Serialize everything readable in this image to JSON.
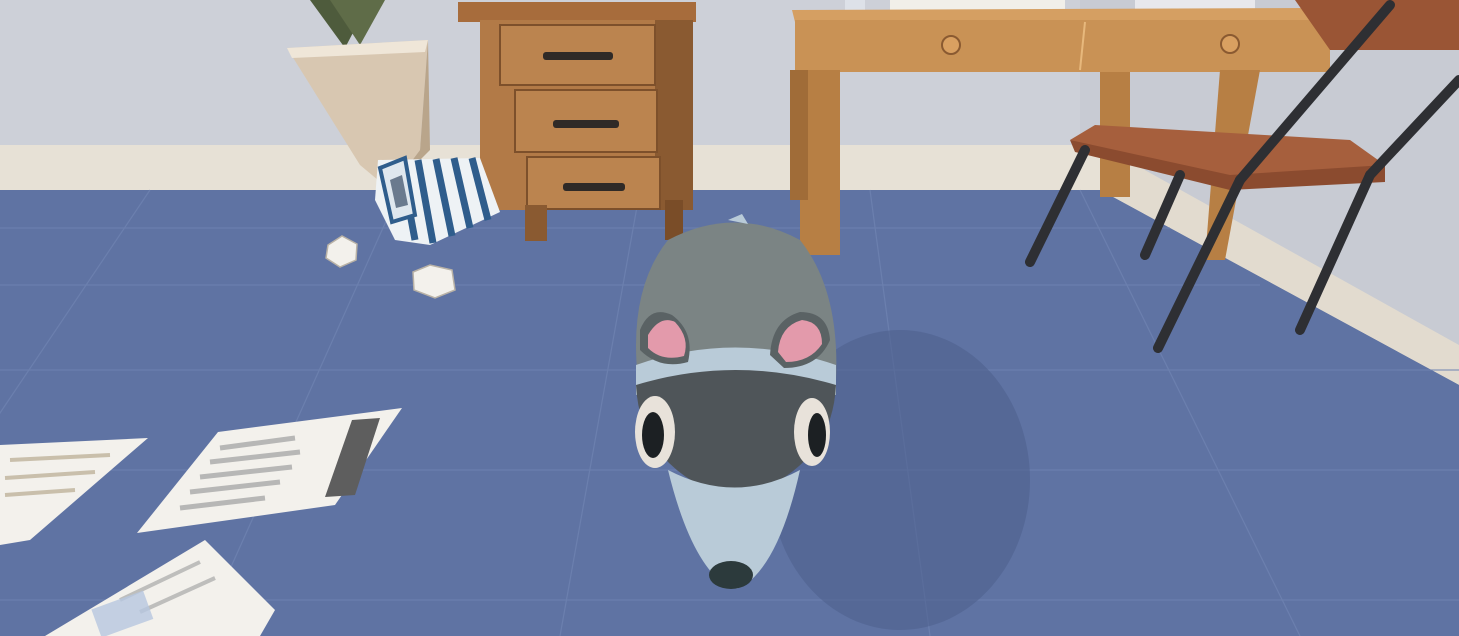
{
  "scene": {
    "kind": "3d-game-view",
    "colors": {
      "wall": "#cdd0d8",
      "baseboard": "#e7e1d6",
      "floor": "#5f73a3",
      "floor_grid": "#6f83b1",
      "wood": "#b27a47",
      "wood_dark": "#8a5a31",
      "desk_wood": "#c99255",
      "chair_seat": "#a65f3d",
      "chair_metal": "#2e2f33",
      "vase": "#d8c7b1",
      "plant": "#4e5b3c",
      "bin_stripe": "#2f5d8c",
      "bin_white": "#eef2f5",
      "paper": "#f3f1ec",
      "paper_ink": "#8f8f8f",
      "mouse_body": "#7b8484",
      "mouse_mask": "#4f5559",
      "mouse_face": "#b9cbd8",
      "mouse_ear_inner": "#e39aab",
      "mouse_eye": "#1c2023",
      "mouse_nose": "#2c3a3c"
    },
    "objects": [
      {
        "name": "potted-plant",
        "icon": "plant-icon"
      },
      {
        "name": "drawer-cabinet",
        "icon": "cabinet-icon"
      },
      {
        "name": "wooden-desk",
        "icon": "desk-icon"
      },
      {
        "name": "chair",
        "icon": "chair-icon"
      },
      {
        "name": "tipped-waste-bin",
        "icon": "bin-icon"
      },
      {
        "name": "crumpled-paper",
        "icon": "paper-ball-icon"
      },
      {
        "name": "papers-on-floor",
        "icon": "document-icon"
      },
      {
        "name": "player-mouse",
        "icon": "mouse-icon"
      }
    ]
  }
}
